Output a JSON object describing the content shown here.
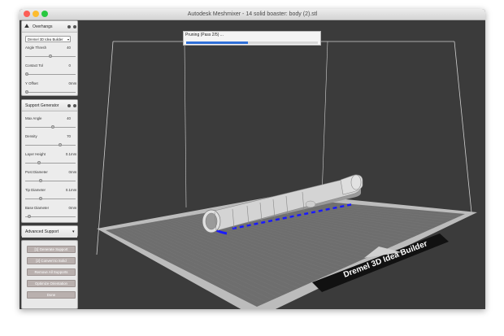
{
  "window": {
    "title": "Autodesk Meshmixer - 14 solid boaster: body (2).stl",
    "traffic_light_colors": [
      "#fc5f57",
      "#fdbc2e",
      "#28c840"
    ]
  },
  "progress": {
    "text": "Pruning (Pass 2/5) ...",
    "value": 0.47,
    "color": "#2f6fd6"
  },
  "overhangs": {
    "title": "Overhangs",
    "preset": "Dremel 3D Idea Builder",
    "fields": [
      {
        "label": "Angle Thresh",
        "value": "40",
        "unit": "",
        "level": 0.5
      },
      {
        "label": "Contact Tol",
        "value": "0",
        "unit": "",
        "level": 0.0
      },
      {
        "label": "Y Offset",
        "value": "0",
        "unit": "mm",
        "level": 0.0
      }
    ]
  },
  "support_generator": {
    "title": "Support Generator",
    "fields": [
      {
        "label": "Max Angle",
        "value": "40",
        "unit": "",
        "level": 0.55
      },
      {
        "label": "Density",
        "value": "70",
        "unit": "",
        "level": 0.7
      },
      {
        "label": "Layer Height",
        "value": "0.1",
        "unit": "mm",
        "level": 0.25
      },
      {
        "label": "Post Diameter",
        "value": "0",
        "unit": "mm",
        "level": 0.3
      },
      {
        "label": "Tip Diameter",
        "value": "0.1",
        "unit": "mm",
        "level": 0.3
      },
      {
        "label": "Base Diameter",
        "value": "0",
        "unit": "mm",
        "level": 0.05
      }
    ]
  },
  "advanced": {
    "title": "Advanced Support"
  },
  "actions": {
    "buttons": [
      {
        "label": "[1] Generate Support",
        "name": "generate-support-button"
      },
      {
        "label": "[2] Convert to Solid",
        "name": "convert-to-solid-button"
      },
      {
        "label": "Remove All Supports",
        "name": "remove-all-supports-button"
      },
      {
        "label": "Optimize Orientation",
        "name": "optimize-orientation-button"
      },
      {
        "label": "Done",
        "name": "done-button"
      }
    ]
  },
  "scene": {
    "bed_label": "Dremel 3D Idea Builder",
    "support_color": "#1a1aff"
  }
}
